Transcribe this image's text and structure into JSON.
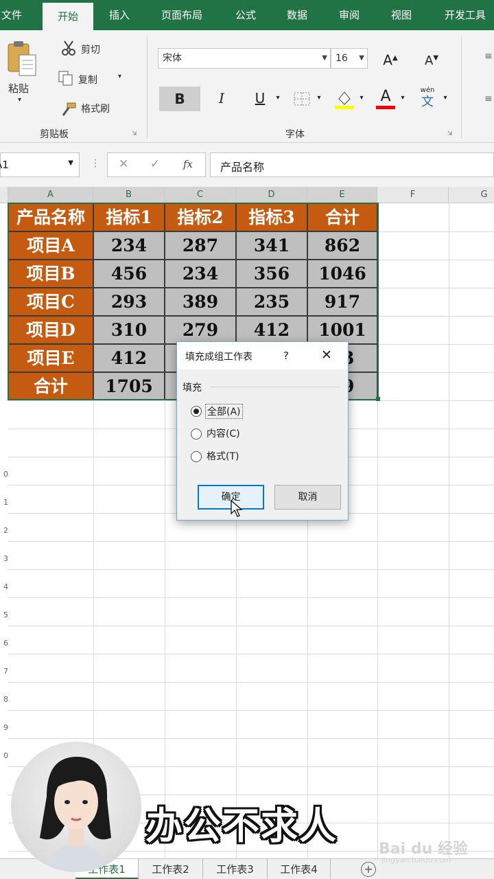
{
  "menu": {
    "tabs": [
      "文件",
      "开始",
      "插入",
      "页面布局",
      "公式",
      "数据",
      "审阅",
      "视图",
      "开发工具"
    ],
    "active": "开始"
  },
  "ribbon": {
    "clipboard": {
      "paste": "粘贴",
      "cut": "剪切",
      "copy": "复制",
      "format_painter": "格式刷",
      "group_label": "剪贴板"
    },
    "font": {
      "name": "宋体",
      "size": "16",
      "bold": "B",
      "italic": "I",
      "underline": "U",
      "font_color_glyph": "A",
      "grow_glyph": "A",
      "shrink_glyph": "A",
      "phonetic_glyph": "文",
      "phonetic_top": "wén",
      "group_label": "字体"
    },
    "accent_fill": "#ffff00",
    "accent_font": "#ff0000"
  },
  "formula_bar": {
    "name_box": "A1",
    "fx": "fx",
    "cancel": "✕",
    "enter": "✓",
    "content": "产品名称"
  },
  "columns": [
    "A",
    "B",
    "C",
    "D",
    "E",
    "F",
    "G"
  ],
  "table": {
    "header": [
      "产品名称",
      "指标1",
      "指标2",
      "指标3",
      "合计"
    ],
    "rows": [
      [
        "项目A",
        "234",
        "287",
        "341",
        "862"
      ],
      [
        "项目B",
        "456",
        "234",
        "356",
        "1046"
      ],
      [
        "项目C",
        "293",
        "389",
        "235",
        "917"
      ],
      [
        "项目D",
        "310",
        "279",
        "412",
        "1001"
      ],
      [
        "项目E",
        "412",
        "",
        "",
        "63"
      ],
      [
        "合计",
        "1705",
        "",
        "",
        "39"
      ]
    ],
    "header_color": "#c55a11",
    "value_color": "#bfbfbf"
  },
  "row_numbers": [
    "0",
    "1",
    "2",
    "3",
    "4",
    "5",
    "6",
    "7",
    "8",
    "9",
    "0"
  ],
  "dialog": {
    "title": "填充成组工作表",
    "help": "?",
    "close": "✕",
    "group_label": "填充",
    "options": [
      "全部(A)",
      "内容(C)",
      "格式(T)"
    ],
    "selected": "全部(A)",
    "ok": "确定",
    "cancel": "取消"
  },
  "sheets": {
    "tabs": [
      "工作表1",
      "工作表2",
      "工作表3",
      "工作表4"
    ],
    "active": "工作表1",
    "add": "+"
  },
  "overlay": {
    "brand_text": "办公不求人",
    "watermark": "Bai du 经验",
    "watermark_sub": "jingyan.baidu.com"
  }
}
